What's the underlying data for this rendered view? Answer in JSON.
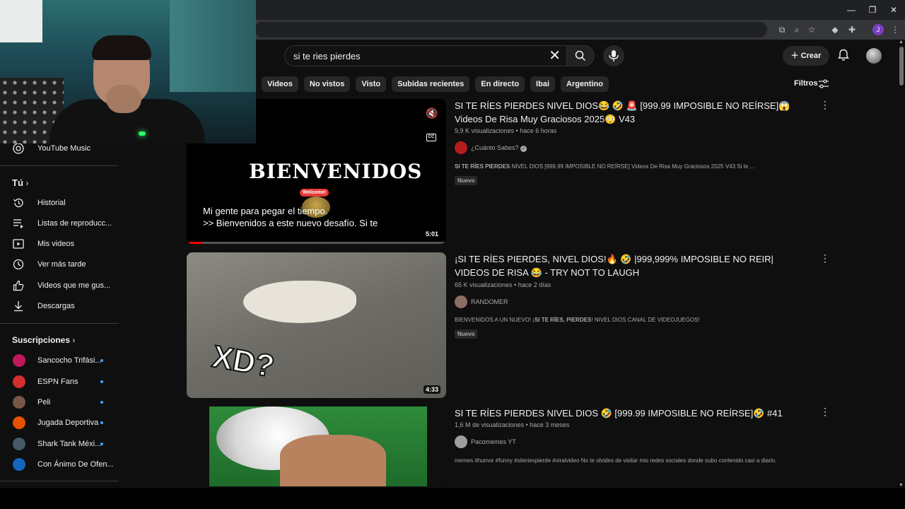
{
  "search": {
    "query": "si te ries pierdes"
  },
  "header": {
    "create_label": "Crear"
  },
  "chips": [
    "Videos",
    "No vistos",
    "Visto",
    "Subidas recientes",
    "En directo",
    "Ibai",
    "Argentino"
  ],
  "filters_label": "Filtros",
  "sidebar": {
    "music": "YouTube Music",
    "you_heading": "Tú",
    "you_items": [
      "Historial",
      "Listas de reproducc...",
      "Mis videos",
      "Ver más tarde",
      "Videos que me gus...",
      "Descargas"
    ],
    "subs_heading": "Suscripciones",
    "subs": [
      {
        "name": "Sancocho Trifási...",
        "color": "#c2185b"
      },
      {
        "name": "ESPN Fans",
        "color": "#d32f2f"
      },
      {
        "name": "Peli",
        "color": "#795548"
      },
      {
        "name": "Jugada Deportiva",
        "color": "#e65100"
      },
      {
        "name": "Shark Tank Méxi...",
        "color": "#455a64"
      },
      {
        "name": "Con Ánimo De Ofen...",
        "color": "#1565c0"
      }
    ]
  },
  "videos": [
    {
      "title": "SI TE RÍES PIERDES NIVEL DIOS😂 🤣 🚨 [999.99 IMPOSIBLE NO REÍRSE]😱Videos De Risa Muy Graciosos 2025😳 V43",
      "views": "9,9 K visualizaciones",
      "age": "hace 6 horas",
      "channel": "¿Cuánto Sabes?",
      "desc_bold": "SI TE RÍES PIERDES",
      "desc_rest": " NIVEL DIOS [999.99 IMPOSIBLE NO REÍRSE] Videos De Risa Muy Graciosos 2025 V43 Si te ...",
      "badge": "Nuevo",
      "duration": "5:01",
      "overlay_title": "BIENVENIDOS",
      "overlay_badge": "Welcome!",
      "caption_line1": "Mi gente para pegar el tiempo.",
      "caption_line2": ">> Bienvenidos a este nuevo desafío. Si te",
      "progress": 0.06
    },
    {
      "title": "¡SI TE RÍES PIERDES, NIVEL DIOS!🔥 🤣 |999,999% IMPOSIBLE NO REIR| VIDEOS DE RISA 😂 - TRY NOT TO LAUGH",
      "views": "65 K visualizaciones",
      "age": "hace 2 días",
      "channel": "RANDOMER",
      "desc_pre": "BIENVENIDOS A UN NUEVO! ¡",
      "desc_bold": "SI TE RÍES, PIERDES",
      "desc_rest": "! NIVEL DIOS CANAL DE VIDEOJUEGOS!",
      "badge": "Nuevo",
      "duration": "4:33",
      "overlay_text": "XD?"
    },
    {
      "title": "SI TE RÍES PIERDES NIVEL DIOS 🤣 [999.99 IMPOSIBLE NO REÍRSE]🤣 #41",
      "views": "1,6 M de visualizaciones",
      "age": "hace 3 meses",
      "channel": "Pacomemes YT",
      "desc_rest": "memes #humor #funny #siteriespierde #viralvideo No te olvides de visitar mis redes sociales donde subo contenido casi a diario."
    }
  ],
  "colors": {
    "background": "#0f0f0f",
    "chip": "#272727",
    "accent_blue": "#3ea6ff",
    "subtitle_gray": "#aaaaaa"
  }
}
